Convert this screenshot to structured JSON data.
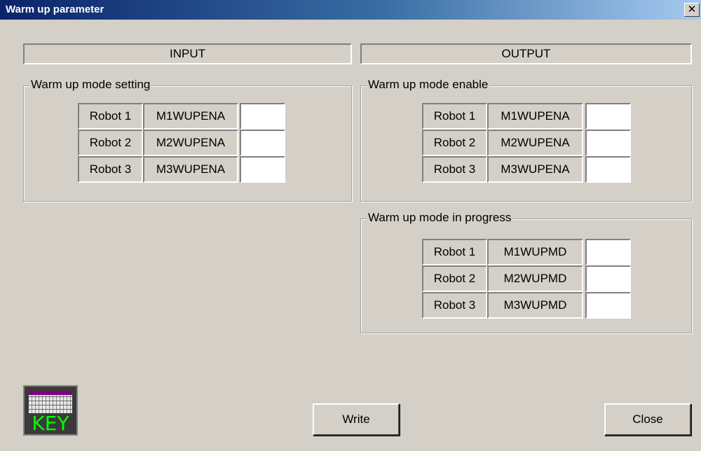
{
  "window": {
    "title": "Warm up parameter",
    "close_glyph": "✕"
  },
  "input": {
    "header": "INPUT",
    "group_title": "Warm up mode setting",
    "rows": [
      {
        "robot": "Robot 1",
        "signal": "M1WUPENA",
        "value": ""
      },
      {
        "robot": "Robot 2",
        "signal": "M2WUPENA",
        "value": ""
      },
      {
        "robot": "Robot 3",
        "signal": "M3WUPENA",
        "value": ""
      }
    ]
  },
  "output": {
    "header": "OUTPUT",
    "enable_group": {
      "title": "Warm up mode enable",
      "rows": [
        {
          "robot": "Robot 1",
          "signal": "M1WUPENA",
          "value": ""
        },
        {
          "robot": "Robot 2",
          "signal": "M2WUPENA",
          "value": ""
        },
        {
          "robot": "Robot 3",
          "signal": "M3WUPENA",
          "value": ""
        }
      ]
    },
    "progress_group": {
      "title": "Warm up mode in progress",
      "rows": [
        {
          "robot": "Robot 1",
          "signal": "M1WUPMD",
          "value": ""
        },
        {
          "robot": "Robot 2",
          "signal": "M2WUPMD",
          "value": ""
        },
        {
          "robot": "Robot 3",
          "signal": "M3WUPMD",
          "value": ""
        }
      ]
    }
  },
  "buttons": {
    "write": "Write",
    "close": "Close",
    "key": "KEY"
  },
  "icons": {
    "keyboard": "keyboard-icon"
  }
}
